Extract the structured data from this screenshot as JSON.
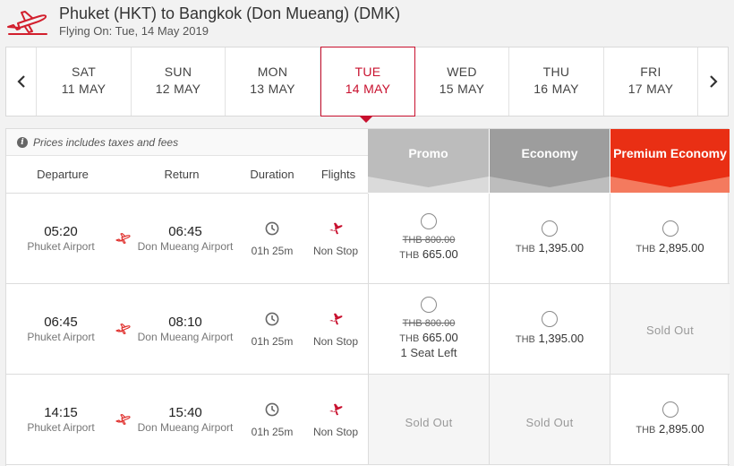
{
  "header": {
    "title": "Phuket (HKT) to Bangkok (Don Mueang) (DMK)",
    "subtitle": "Flying On: Tue, 14 May 2019",
    "logo_icon": "airplane-takeoff-icon",
    "accent_color": "#c8102e"
  },
  "dates": [
    {
      "dow": "SAT",
      "date": "11 MAY",
      "active": false
    },
    {
      "dow": "SUN",
      "date": "12 MAY",
      "active": false
    },
    {
      "dow": "MON",
      "date": "13 MAY",
      "active": false
    },
    {
      "dow": "TUE",
      "date": "14 MAY",
      "active": true
    },
    {
      "dow": "WED",
      "date": "15 MAY",
      "active": false
    },
    {
      "dow": "THU",
      "date": "16 MAY",
      "active": false
    },
    {
      "dow": "FRI",
      "date": "17 MAY",
      "active": false
    }
  ],
  "table": {
    "note": "Prices includes taxes and fees",
    "columns": {
      "departure": "Departure",
      "return": "Return",
      "duration": "Duration",
      "flights": "Flights"
    },
    "fare_classes": [
      {
        "name": "Promo",
        "color": "#bcbcbc"
      },
      {
        "name": "Economy",
        "color": "#9d9d9d"
      },
      {
        "name": "Premium Economy",
        "color": "#e92f14"
      }
    ],
    "rows": [
      {
        "dep_time": "05:20",
        "dep_place": "Phuket Airport",
        "arr_time": "06:45",
        "arr_place": "Don Mueang Airport",
        "duration": "01h 25m",
        "flights": "Non Stop",
        "promo": {
          "currency": "THB",
          "old": "THB 800.00",
          "amount": "665.00",
          "seats": ""
        },
        "economy": {
          "currency": "THB",
          "amount": "1,395.00"
        },
        "premium": {
          "currency": "THB",
          "amount": "2,895.00",
          "sold_out": false
        }
      },
      {
        "dep_time": "06:45",
        "dep_place": "Phuket Airport",
        "arr_time": "08:10",
        "arr_place": "Don Mueang Airport",
        "duration": "01h 25m",
        "flights": "Non Stop",
        "promo": {
          "currency": "THB",
          "old": "THB 800.00",
          "amount": "665.00",
          "seats": "1 Seat Left"
        },
        "economy": {
          "currency": "THB",
          "amount": "1,395.00"
        },
        "premium": {
          "sold_out_label": "Sold Out"
        }
      },
      {
        "dep_time": "14:15",
        "dep_place": "Phuket Airport",
        "arr_time": "15:40",
        "arr_place": "Don Mueang Airport",
        "duration": "01h 25m",
        "flights": "Non Stop",
        "promo": {
          "sold_out_label": "Sold Out"
        },
        "economy": {
          "sold_out_label": "Sold Out"
        },
        "premium": {
          "currency": "THB",
          "amount": "2,895.00"
        }
      }
    ]
  }
}
